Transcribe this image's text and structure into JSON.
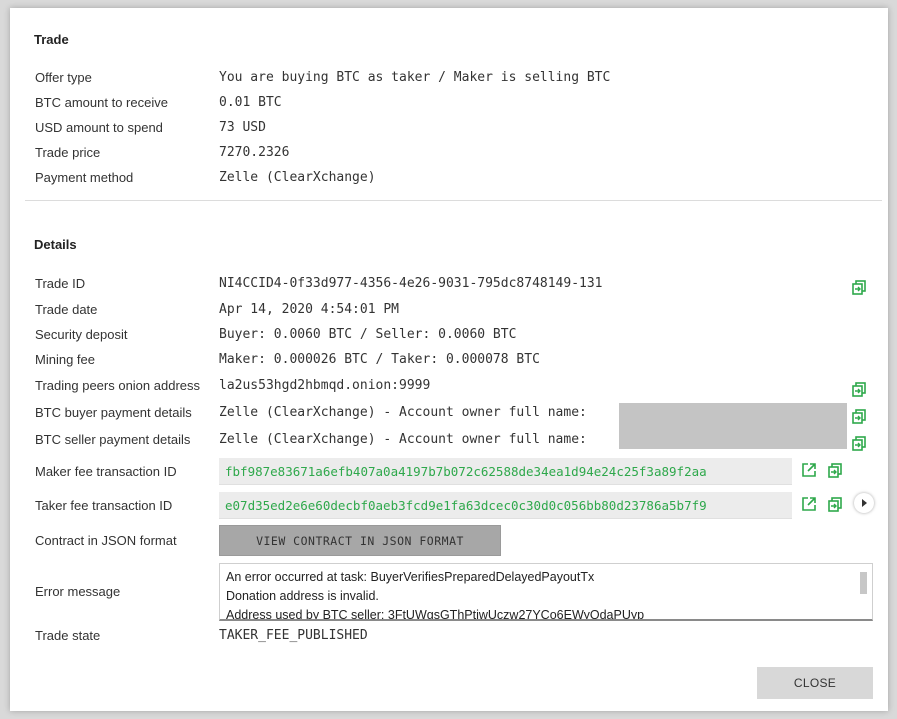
{
  "trade": {
    "title": "Trade",
    "offer_type": {
      "label": "Offer type",
      "value": "You are buying BTC as taker / Maker is selling BTC"
    },
    "btc_amount": {
      "label": "BTC amount to receive",
      "value": "0.01 BTC"
    },
    "usd_amount": {
      "label": "USD amount to spend",
      "value": "73 USD"
    },
    "trade_price": {
      "label": "Trade price",
      "value": "7270.2326"
    },
    "payment_method": {
      "label": "Payment method",
      "value": "Zelle (ClearXchange)"
    }
  },
  "details": {
    "title": "Details",
    "trade_id": {
      "label": "Trade ID",
      "value": "NI4CCID4-0f33d977-4356-4e26-9031-795dc8748149-131"
    },
    "trade_date": {
      "label": "Trade date",
      "value": "Apr 14, 2020 4:54:01 PM"
    },
    "security_deposit": {
      "label": "Security deposit",
      "value": "Buyer: 0.0060 BTC / Seller: 0.0060 BTC"
    },
    "mining_fee": {
      "label": "Mining fee",
      "value": "Maker: 0.000026 BTC / Taker: 0.000078 BTC"
    },
    "onion_address": {
      "label": "Trading peers onion address",
      "value": "la2us53hgd2hbmqd.onion:9999"
    },
    "buyer_payment": {
      "label": "BTC buyer payment details",
      "value": "Zelle (ClearXchange) - Account owner full name:"
    },
    "seller_payment": {
      "label": "BTC seller payment details",
      "value": "Zelle (ClearXchange) - Account owner full name:"
    },
    "maker_fee_tx": {
      "label": "Maker fee transaction ID",
      "value": "fbf987e83671a6efb407a0a4197b7b072c62588de34ea1d94e24c25f3a89f2aa"
    },
    "taker_fee_tx": {
      "label": "Taker fee transaction ID",
      "value": "e07d35ed2e6e60decbf0aeb3fcd9e1fa63dcec0c30d0c056bb80d23786a5b7f9"
    },
    "contract": {
      "label": "Contract in JSON format",
      "button": "VIEW CONTRACT IN JSON FORMAT"
    },
    "error": {
      "label": "Error message",
      "lines": [
        "An error occurred at task: BuyerVerifiesPreparedDelayedPayoutTx",
        "Donation address is invalid.",
        "Address used by BTC seller: 3FtUWgsGThPtiwUczw27YCo6EWyQdaPUyp"
      ]
    },
    "trade_state": {
      "label": "Trade state",
      "value": "TAKER_FEE_PUBLISHED"
    }
  },
  "footer": {
    "close_label": "CLOSE"
  },
  "icons": {
    "copy": "copy-icon",
    "external": "external-link-icon",
    "play": "play-icon"
  },
  "colors": {
    "accent_green": "#2ea84b",
    "masked_gray": "#c4c4c4"
  }
}
